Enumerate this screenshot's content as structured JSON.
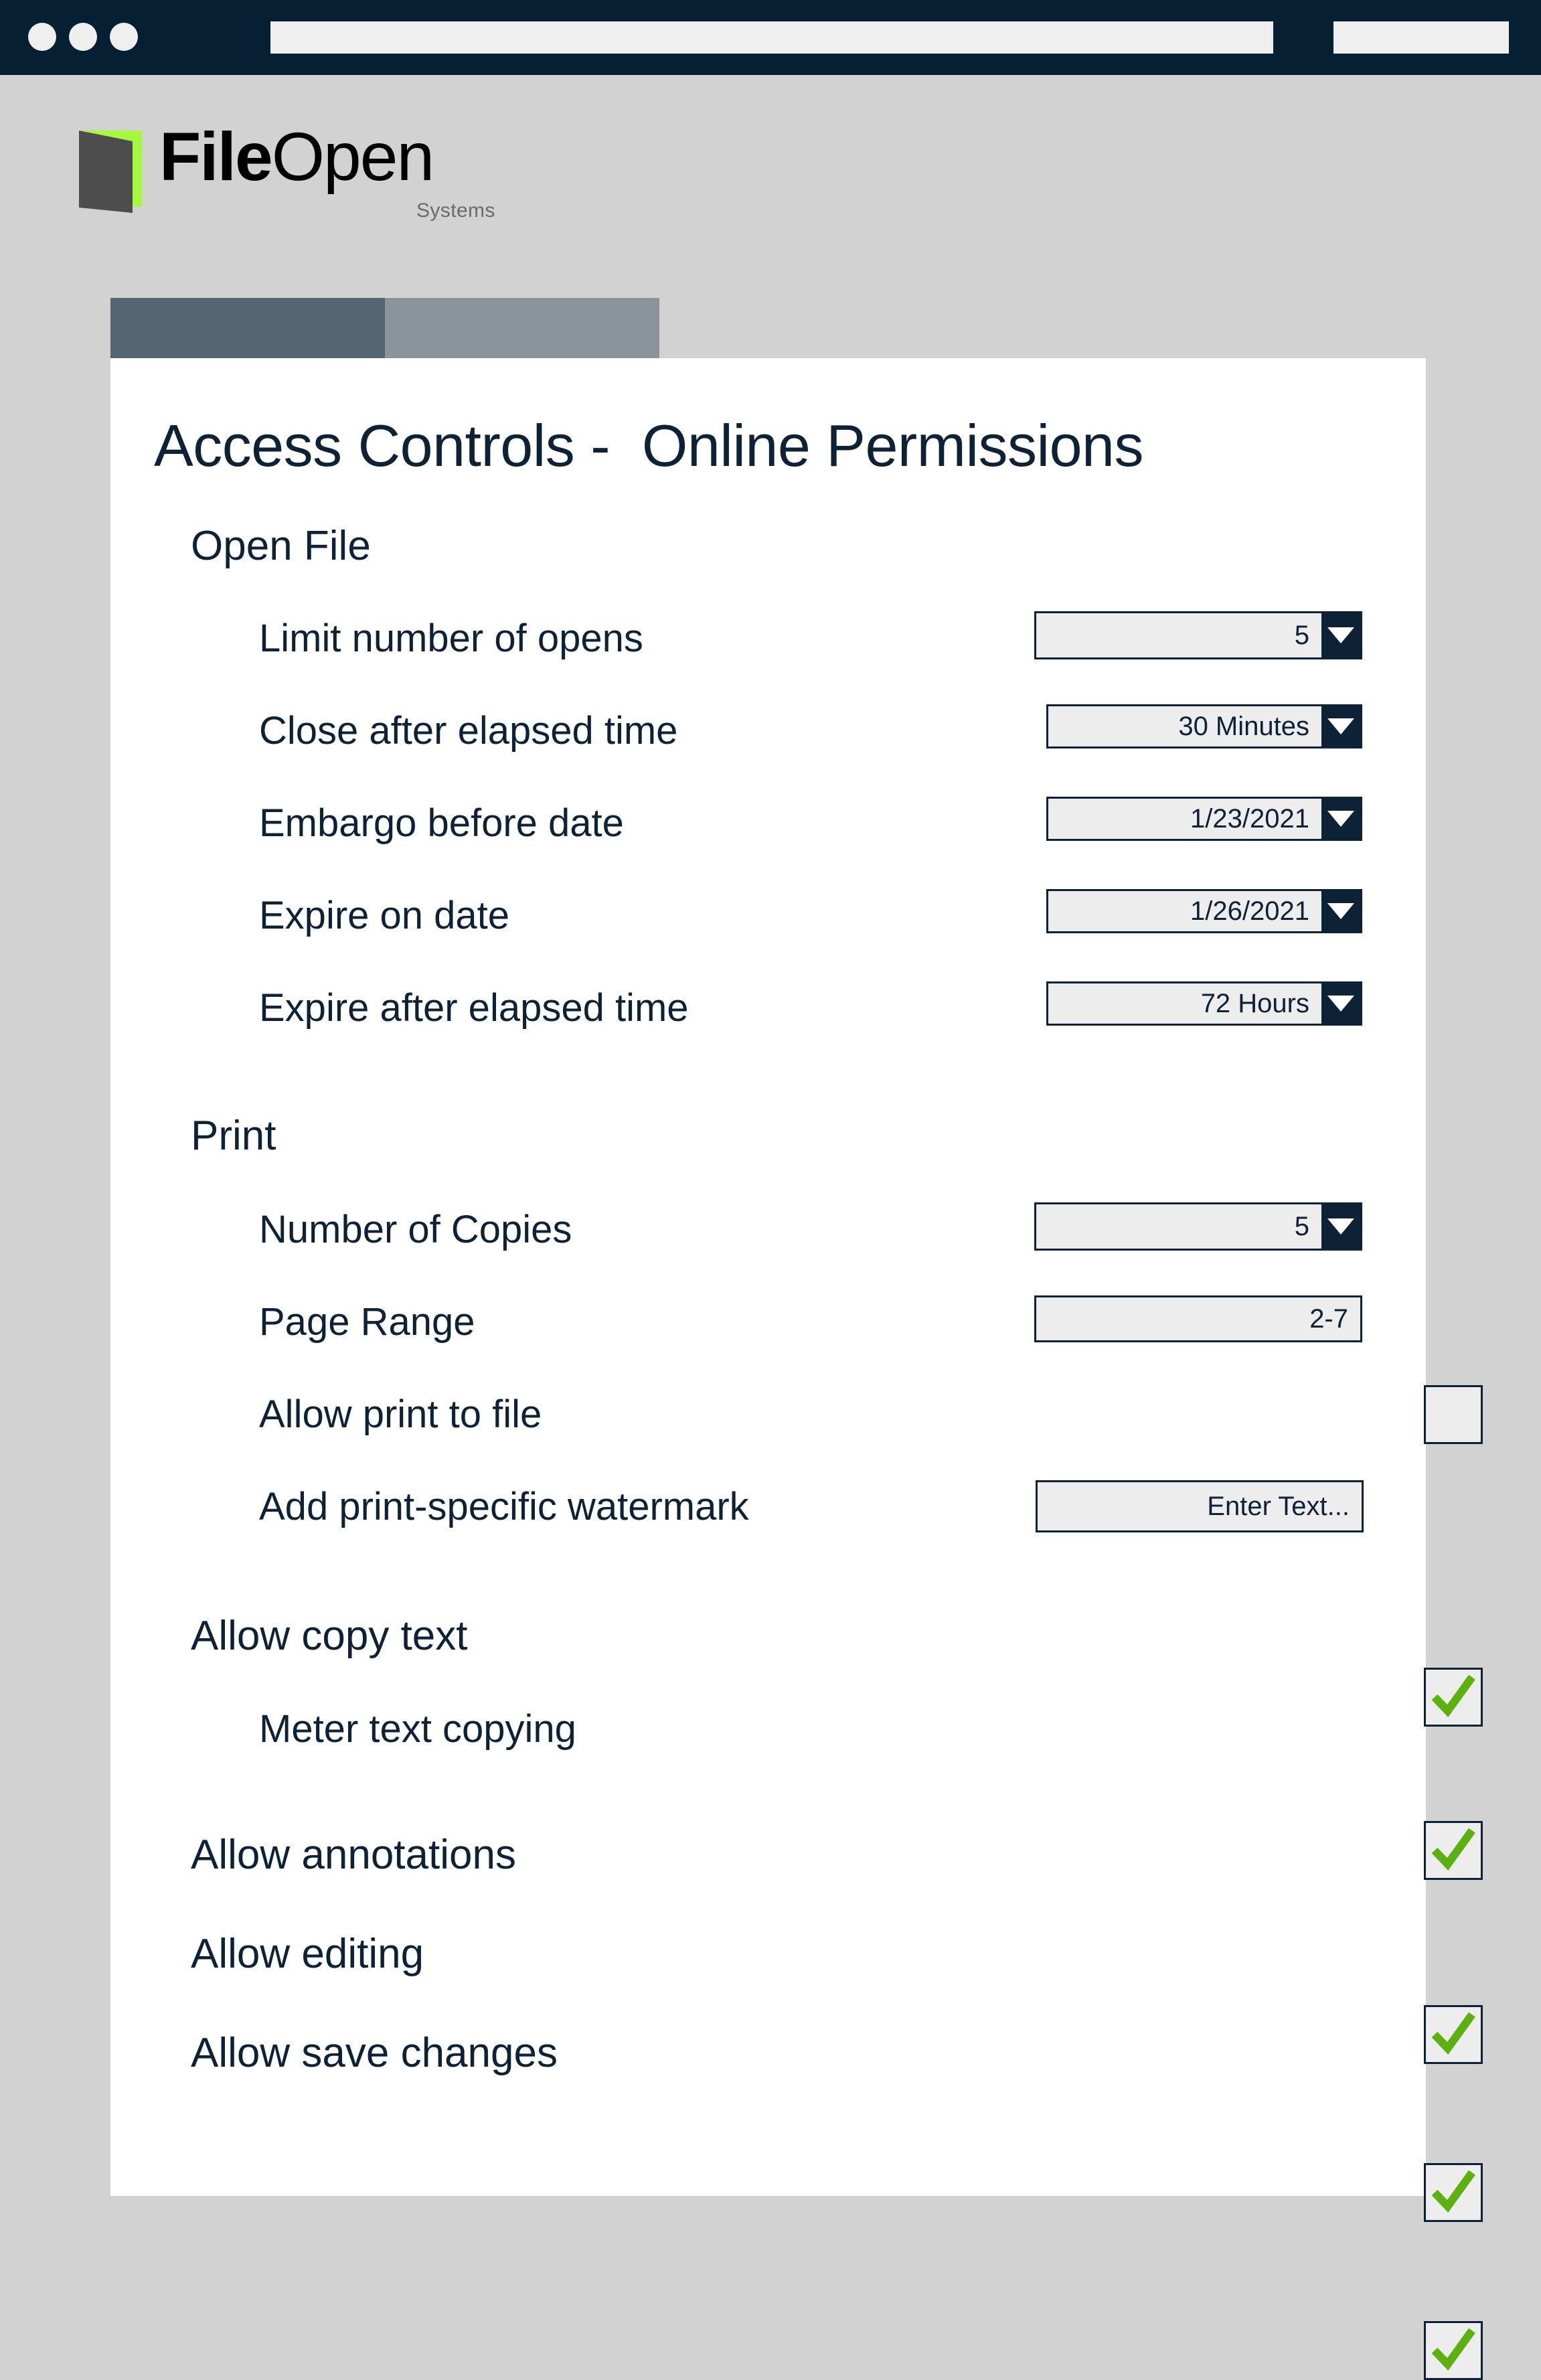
{
  "browser": {
    "dots": [
      "window-dot-1",
      "window-dot-2",
      "window-dot-3"
    ],
    "address_value": "",
    "address_placeholder": "",
    "right_box_value": ""
  },
  "brand": {
    "name_bold": "File",
    "name_light": "Open",
    "tagline": "Systems",
    "mark_icon": "open-book-icon",
    "green": "#a4f93f",
    "dark": "#4d4d4d"
  },
  "tabs": [
    {
      "label": "",
      "active": true
    },
    {
      "label": "",
      "active": false
    }
  ],
  "page": {
    "title": "Access Controls -  Online Permissions"
  },
  "colors": {
    "navy": "#0d2137",
    "chrome": "#061f33",
    "page_bg": "#d2d2d2",
    "field_bg": "#ededed",
    "check_green": "#5cb111",
    "tab_active": "#556573",
    "tab_inactive": "#8b939c"
  },
  "sections": [
    {
      "heading": "Open File",
      "rows": [
        {
          "label": "Limit number of opens",
          "control": "select",
          "value": "5"
        },
        {
          "label": "Close after elapsed time",
          "control": "select",
          "value": "30 Minutes"
        },
        {
          "label": "Embargo before date",
          "control": "select",
          "value": "1/23/2021"
        },
        {
          "label": "Expire on date",
          "control": "select",
          "value": "1/26/2021"
        },
        {
          "label": "Expire after elapsed time",
          "control": "select",
          "value": "72 Hours"
        }
      ]
    },
    {
      "heading": "Print",
      "rows": [
        {
          "label": "Number of Copies",
          "control": "select",
          "value": "5"
        },
        {
          "label": "Page Range",
          "control": "text",
          "value": "2-7"
        },
        {
          "label": "Allow print to file",
          "control": "checkbox",
          "value": "",
          "checked": false
        },
        {
          "label": "Add print-specific watermark",
          "control": "text",
          "value": "Enter Text..."
        }
      ]
    }
  ],
  "toggles": [
    {
      "label": "Allow copy text",
      "checked": true,
      "indent": 1
    },
    {
      "label": "Meter text copying",
      "checked": true,
      "indent": 2
    },
    {
      "label": "Allow annotations",
      "checked": true,
      "indent": 1
    },
    {
      "label": "Allow editing",
      "checked": true,
      "indent": 1
    },
    {
      "label": "Allow save changes",
      "checked": true,
      "indent": 1
    }
  ]
}
